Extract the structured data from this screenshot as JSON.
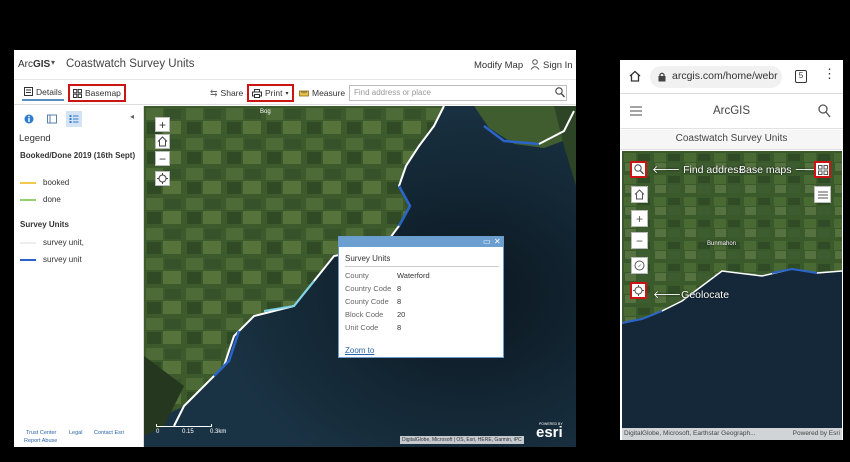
{
  "desktop": {
    "brand_prefix": "Arc",
    "brand_bold": "GIS",
    "title": "Coastwatch Survey Units",
    "modify_map": "Modify Map",
    "sign_in": "Sign In",
    "toolbar": {
      "details": "Details",
      "basemap": "Basemap",
      "share": "Share",
      "print": "Print",
      "measure": "Measure",
      "search_placeholder": "Find address or place"
    },
    "legend": {
      "title": "Legend",
      "layer1_title": "Booked/Done 2019 (16th Sept)",
      "layer1_items": [
        {
          "label": "booked",
          "color": "#f2c94c"
        },
        {
          "label": "done",
          "color": "#8fd46b"
        }
      ],
      "layer2_title": "Survey Units",
      "layer2_items": [
        {
          "label": "survey unit,",
          "color": "#ffffff"
        },
        {
          "label": "survey unit",
          "color": "#2a64c8"
        }
      ]
    },
    "footer": {
      "trust": "Trust Center",
      "legal": "Legal",
      "contact": "Contact Esri",
      "report": "Report Abuse"
    },
    "popup": {
      "title": "Survey Units",
      "fields": [
        {
          "key": "County",
          "value": "Waterford"
        },
        {
          "key": "Country Code",
          "value": "8"
        },
        {
          "key": "County Code",
          "value": "8"
        },
        {
          "key": "Block Code",
          "value": "20"
        },
        {
          "key": "Unit Code",
          "value": "8"
        }
      ],
      "zoom": "Zoom to"
    },
    "map_place": "Bog",
    "scale_labels": [
      "0",
      "0.15",
      "0.3km"
    ],
    "attribution": "DigitalGlobe, Microsoft | OS, Esri, HERE, Garmin, iPC",
    "powered_by": "POWERED BY",
    "esri": "esri"
  },
  "mobile": {
    "url": "arcgis.com/home/webr",
    "tab_count": "5",
    "app_name": "ArcGIS",
    "title": "Coastwatch Survey Units",
    "notes": {
      "find_address": "Find address",
      "base_maps": "Base maps",
      "geolocate": "Geolocate"
    },
    "place": "Bunmahon",
    "attribution_left": "DigitalGlobe, Microsoft, Earthstar Geograph...",
    "attribution_right": "Powered by Esri"
  },
  "colors": {
    "highlight": "#cc1414",
    "accent": "#6b9fd0",
    "survey_line": "#2a64c8"
  }
}
